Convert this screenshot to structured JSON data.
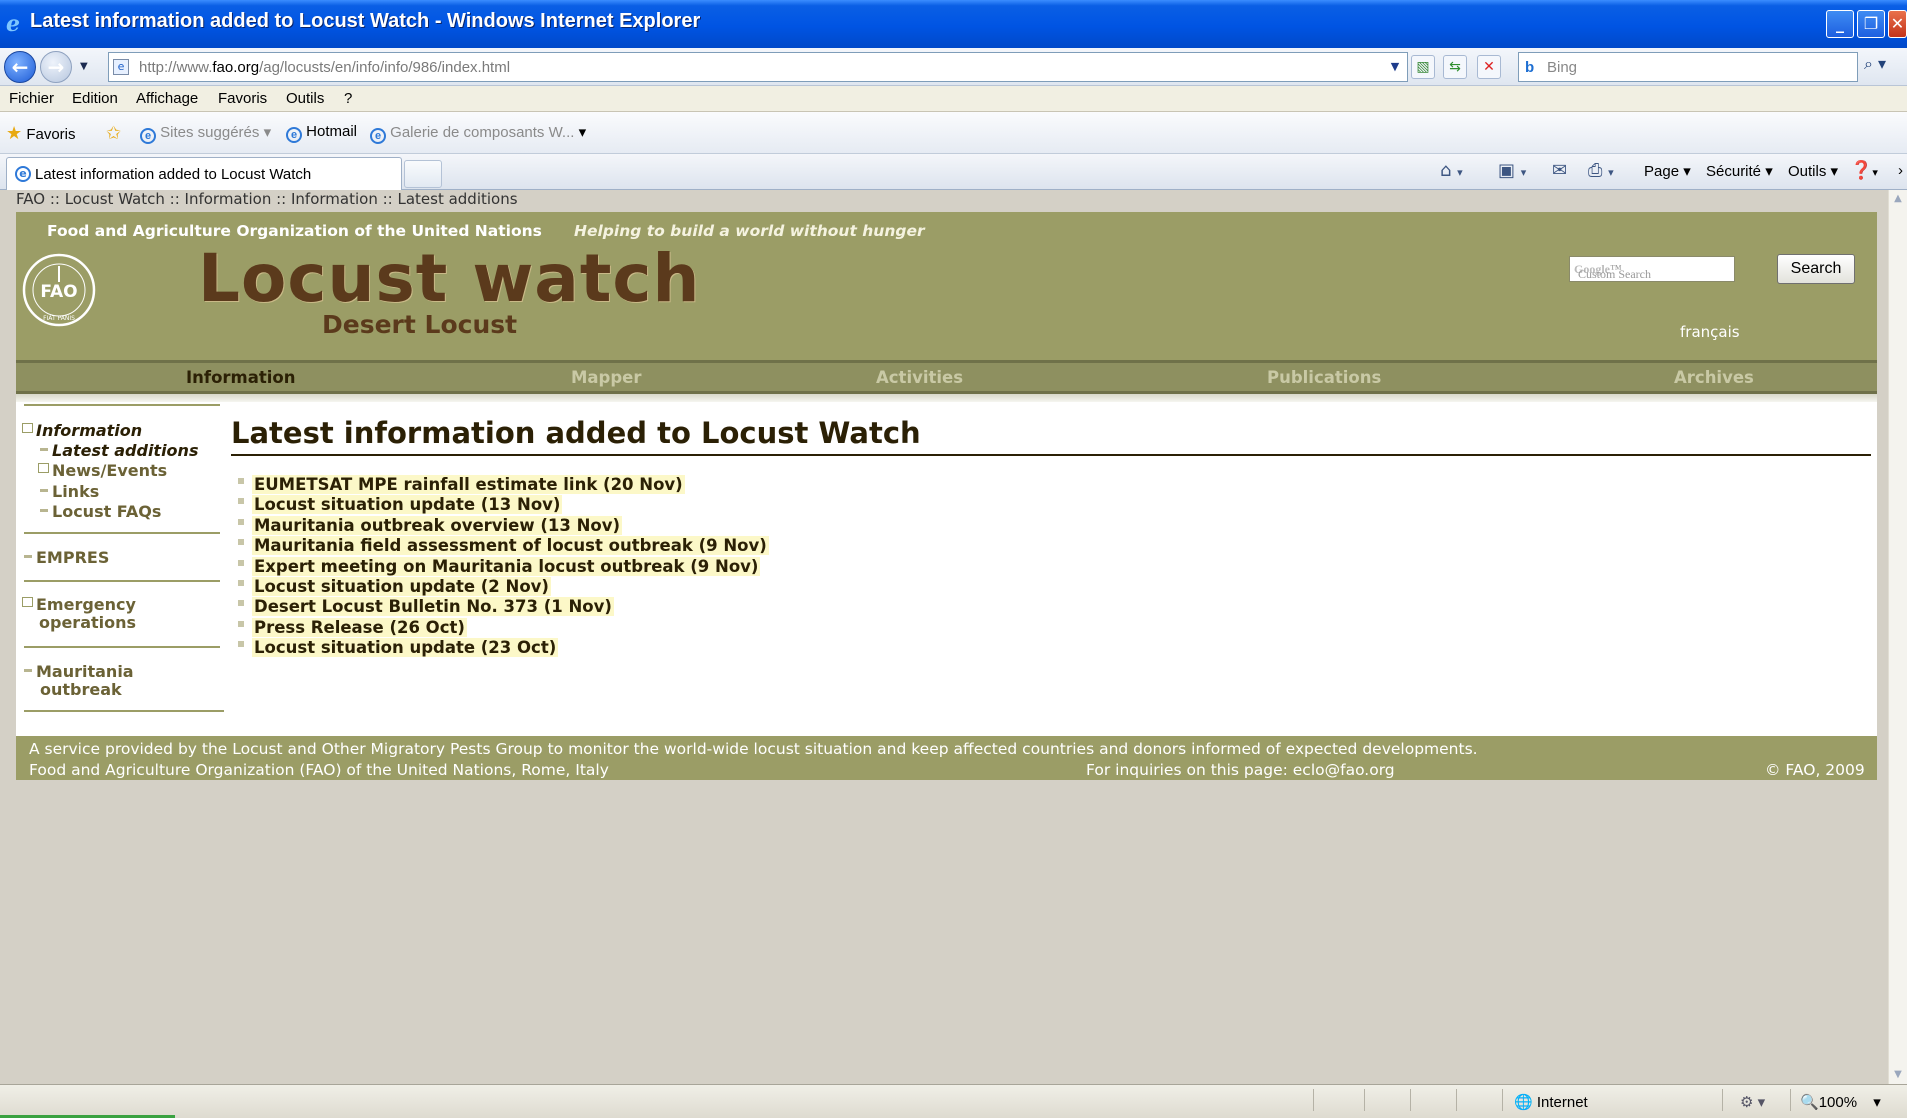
{
  "window": {
    "title": "Latest information added to Locust Watch - Windows Internet Explorer",
    "minimize": "_",
    "restore": "❐",
    "close": "✕"
  },
  "address": {
    "url_prefix": "http://www.",
    "url_domain": "fao.org",
    "url_path": "/ag/locusts/en/info/info/986/index.html",
    "search_placeholder": "Bing",
    "search_icon": "magnifier-icon"
  },
  "menu": [
    "Fichier",
    "Edition",
    "Affichage",
    "Favoris",
    "Outils",
    "?"
  ],
  "favorites": {
    "favoris_label": "Favoris",
    "items": [
      "Sites suggérés",
      "Hotmail",
      "Galerie de composants W..."
    ]
  },
  "tabs": {
    "active_label": "Latest information added to Locust Watch"
  },
  "command_bar": {
    "page": "Page",
    "security": "Sécurité",
    "tools": "Outils"
  },
  "page": {
    "breadcrumb": "FAO :: Locust Watch :: Information :: Information :: Latest additions",
    "header": {
      "org_name": "Food and Agriculture Organization of the United Nations",
      "motto": "Helping to build a world without hunger",
      "site_title": "Locust watch",
      "site_subtitle": "Desert Locust",
      "search_placeholder": "Custom Search",
      "search_button": "Search",
      "language_link": "français",
      "logo_text": "FAO",
      "logo_motto": "FIAT PANIS"
    },
    "nav": [
      "Information",
      "Mapper",
      "Activities",
      "Publications",
      "Archives"
    ],
    "sidebar": {
      "information": "Information",
      "latest_additions": "Latest additions",
      "news_events": "News/Events",
      "links": "Links",
      "faqs": "Locust FAQs",
      "empres": "EMPRES",
      "emergency_1": "Emergency",
      "emergency_2": "operations",
      "mauritania_1": "Mauritania",
      "mauritania_2": "outbreak"
    },
    "heading": "Latest information added to Locust Watch",
    "news": [
      "EUMETSAT MPE rainfall estimate link (20 Nov)",
      "Locust situation update (13 Nov)",
      "Mauritania outbreak overview (13 Nov)",
      "Mauritania field assessment of locust outbreak (9 Nov)",
      "Expert meeting on Mauritania locust outbreak (9 Nov)",
      "Locust situation update (2 Nov)",
      "Desert Locust Bulletin No. 373 (1 Nov)",
      "Press Release (26 Oct)",
      "Locust situation update (23 Oct)"
    ],
    "footer": {
      "line1": "A service provided by the Locust and Other Migratory Pests Group to monitor the world-wide locust situation and keep affected countries and donors informed of expected developments.",
      "line2": "Food and Agriculture Organization (FAO) of the United Nations, Rome, Italy",
      "inquiries": "For inquiries on this page: eclo@fao.org",
      "copyright": "© FAO, 2009"
    }
  },
  "status": {
    "zone": "Internet",
    "zoom": "100%"
  },
  "colors": {
    "header_olive": "#9b9d66",
    "nav_olive": "#8e9060",
    "title_brown": "#5b3a1c",
    "text_dark": "#2b2005",
    "link_highlight": "#fcf8c8",
    "titlebar_blue": "#0054e3"
  }
}
